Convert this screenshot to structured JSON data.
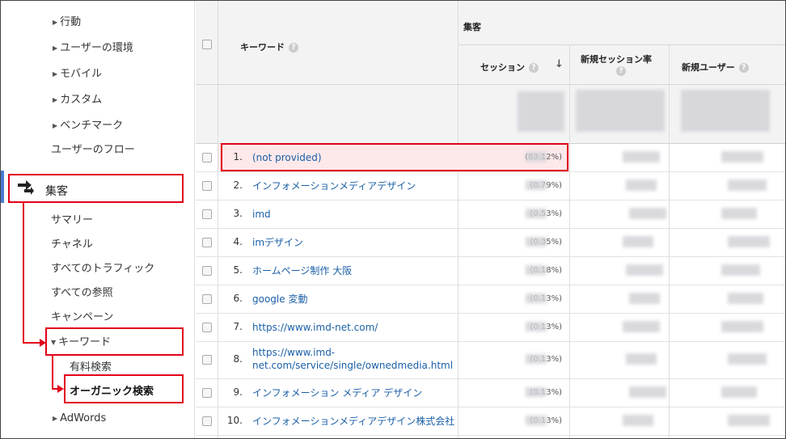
{
  "sidebar": {
    "items": [
      {
        "label": "行動",
        "arrow": "right"
      },
      {
        "label": "ユーザーの環境",
        "arrow": "right"
      },
      {
        "label": "モバイル",
        "arrow": "right"
      },
      {
        "label": "カスタム",
        "arrow": "right"
      },
      {
        "label": "ベンチマーク",
        "arrow": "right"
      },
      {
        "label": "ユーザーのフロー",
        "arrow": "none"
      }
    ],
    "section": {
      "label": "集客",
      "icon": "acquisition-arrows-icon"
    },
    "sub_items": [
      "サマリー",
      "チャネル",
      "すべてのトラフィック",
      "すべての参照",
      "キャンペーン"
    ],
    "keyword": {
      "label": "キーワード",
      "arrow": "down"
    },
    "keyword_children": [
      "有料検索",
      "オーガニック検索"
    ],
    "adwords": {
      "label": "AdWords",
      "arrow": "right"
    }
  },
  "table": {
    "group_header": "集客",
    "keyword_header": "キーワード",
    "columns": [
      {
        "label": "セッション",
        "sorted": "desc"
      },
      {
        "label": "新規セッション率"
      },
      {
        "label": "新規ユーザー"
      }
    ],
    "rows": [
      {
        "num": "1.",
        "keyword": "(not provided)",
        "pct": "(83.12%)"
      },
      {
        "num": "2.",
        "keyword": "インフォメーションメディアデザイン",
        "pct": "(0.79%)"
      },
      {
        "num": "3.",
        "keyword": "imd",
        "pct": "(0.53%)"
      },
      {
        "num": "4.",
        "keyword": "imデザイン",
        "pct": "(0.35%)"
      },
      {
        "num": "5.",
        "keyword": "ホームページ制作 大阪",
        "pct": "(0.18%)"
      },
      {
        "num": "6.",
        "keyword": "google 変動",
        "pct": "(0.13%)"
      },
      {
        "num": "7.",
        "keyword": "https://www.imd-net.com/",
        "pct": "(0.13%)"
      },
      {
        "num": "8.",
        "keyword": "https://www.imd-net.com/service/single/ownedmedia.html",
        "keyword_lines": [
          "https://www.imd-",
          "net.com/service/single/ownedmedia.html"
        ],
        "pct": "(0.13%)"
      },
      {
        "num": "9.",
        "keyword": "インフォメーション メディア デザイン",
        "pct": "(0.13%)"
      },
      {
        "num": "10.",
        "keyword": "インフォメーションメディアデザイン株式会社",
        "pct": "(0.13%)"
      }
    ],
    "help_glyph": "?",
    "sort_glyph": "↓",
    "colors": {
      "link": "#1a5fa6",
      "highlight_row": "#fde8ea",
      "annotation_red": "#e2001a",
      "nav_accent": "#4a7bd0"
    }
  }
}
